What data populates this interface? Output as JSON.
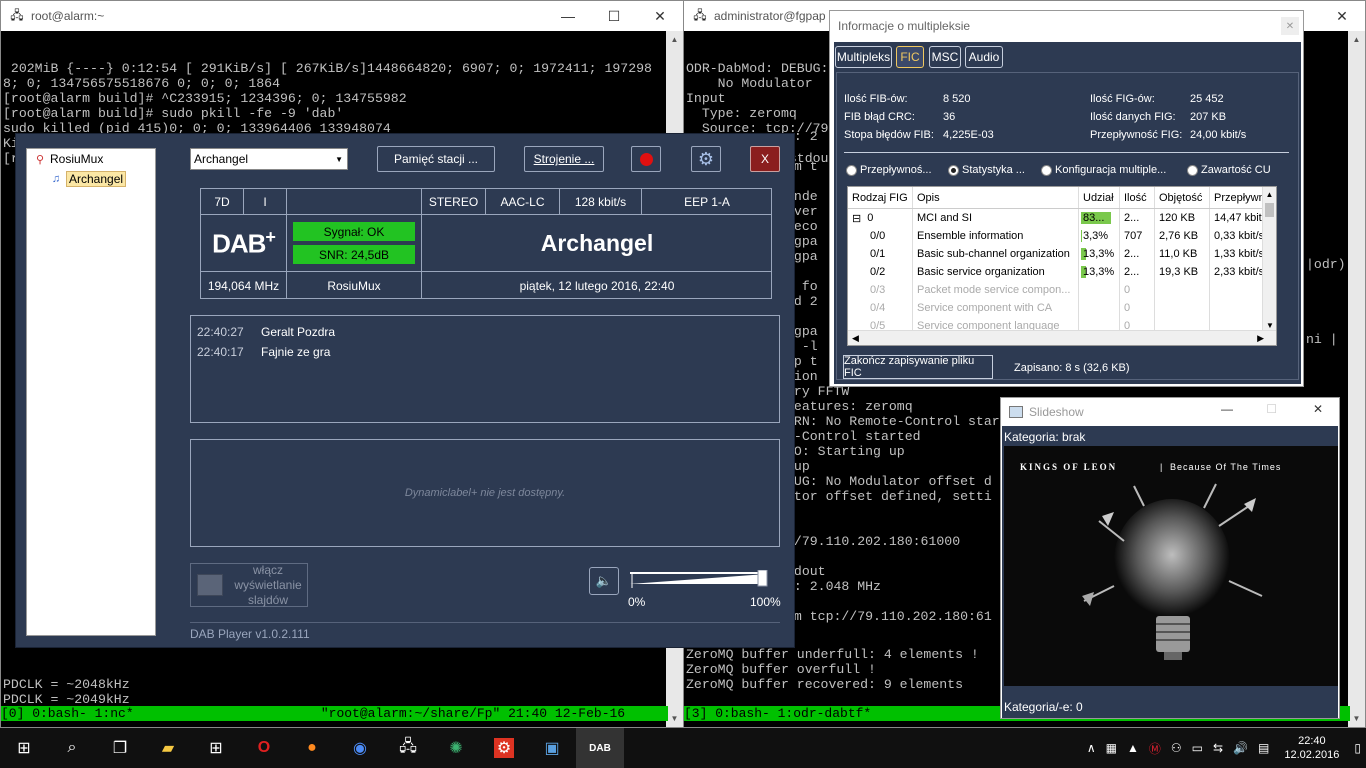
{
  "term_left": {
    "title": "root@alarm:~",
    "lines": [
      " 202MiB {----} 0:12:54 [ 291KiB/s] [ 267KiB/s]1448664820; 6907; 0; 1972411; 197298",
      "8; 0; 134756575518676 0; 0; 0; 1864",
      "[root@alarm build]# ^C233915; 1234396; 0; 134755982",
      "[root@alarm build]# sudo pkill -fe -9 'dab'",
      "sudo killed (pid 415)0; 0; 0; 133964406 133948074",
      "Killed8415; 7195; 0; 0; 0; 0; 133964060; 133964406",
      "[root@alarm build]# nc 172.20.2.23 12345 | pv -B2M -Ithera | ./dab_iS"
    ],
    "tail_lines": [
      "PDCLK = ~2048kHz",
      "PDCLK = ~2049kHz",
      "PDCLK = ~2048kHz"
    ],
    "status": "[0] 0:bash- 1:nc*                        \"root@alarm:~/share/Fp\" 21:40 12-Feb-16"
  },
  "term_right": {
    "title": "administrator@fgpap",
    "lines": [
      "ODR-DabMod: DEBUG:",
      "    No Modulator",
      "Input",
      "  Type: zeromq",
      "  Source: tcp://79",
      "Output",
      "  Name: /dev/stdout"
    ],
    "mid_lines": [
      "e: 2",
      "",
      "om t",
      "",
      "unde",
      "over",
      "reco",
      "fgpa",
      "fgpa",
      "",
      "d fo",
      "id 2",
      "",
      "fgpa",
      "c -l",
      "up t",
      "sion",
      "ary FFTW",
      "features: zeromq",
      "ARN: No Remote-Control star",
      "e-Control started",
      "FO: Starting up",
      " up",
      "BUG: No Modulator offset d",
      "ator offset defined, setti",
      "",
      "",
      "//79.110.202.180:61000",
      "",
      "tdout",
      "e: 2.048 MHz",
      "",
      "om tcp://79.110.202.180:61"
    ],
    "tail_lines": [
      "ZeroMQ buffer underfull: 4 elements !",
      "ZeroMQ buffer overfull !",
      "ZeroMQ buffer recovered: 9 elements"
    ],
    "status": "[3] 0:bash- 1:odr-dabtf*",
    "right_snips": [
      "|odr)",
      "ni |"
    ]
  },
  "dab": {
    "tree_root": "RosiuMux",
    "tree_child": "Archangel",
    "station_combo": "Archangel",
    "btn_memory": "Pamięć stacji ...",
    "btn_tuning": "Strojenie ...",
    "close": "X",
    "grid": {
      "channel": "7D",
      "i": "I",
      "stereo": "STEREO",
      "codec": "AAC-LC",
      "bitrate": "128 kbit/s",
      "eep": "EEP 1-A",
      "signal": "Sygnał: OK",
      "snr": "SNR: 24,5dB",
      "station_name": "Archangel",
      "freq": "194,064 MHz",
      "mux": "RosiuMux",
      "datetime": "piątek, 12 lutego 2016, 22:40"
    },
    "messages": [
      {
        "time": "22:40:27",
        "text": "Geralt Pozdra"
      },
      {
        "time": "22:40:17",
        "text": "Fajnie ze gra"
      }
    ],
    "dl_plus": "Dynamiclabel+ nie jest dostępny.",
    "slides_btn": [
      "włącz",
      "wyświetlanie",
      "slajdów"
    ],
    "vol_min": "0%",
    "vol_max": "100%",
    "volume": 1.0,
    "version": "DAB Player v1.0.2.111",
    "signal_color": "#22c322"
  },
  "mux": {
    "title": "Informacje o multipleksie",
    "tabs": [
      "Multipleks",
      "FIC",
      "MSC",
      "Audio"
    ],
    "active_tab": "FIC",
    "stats": {
      "fib_count_label": "Ilość FIB-ów:",
      "fib_count": "8 520",
      "fig_count_label": "Ilość FIG-ów:",
      "fig_count": "25 452",
      "crc_label": "FIB błąd CRC:",
      "crc": "36",
      "fig_data_label": "Ilość danych FIG:",
      "fig_data": "207 KB",
      "err_label": "Stopa błędów FIB:",
      "err": "4,225E-03",
      "thr_label": "Przepływność FIG:",
      "thr": "24,00 kbit/s"
    },
    "radios": [
      "Przepływnoś...",
      "Statystyka ...",
      "Konfiguracja multiple...",
      "Zawartość CU"
    ],
    "columns": [
      "Rodzaj FIG",
      "Opis",
      "Udział",
      "Ilość",
      "Objętość",
      "Przepływność"
    ],
    "rows": [
      {
        "type": "0",
        "desc": "MCI and SI",
        "share": "83...",
        "share_pct": 83,
        "count": "2...",
        "vol": "120 KB",
        "thr": "14,47 kbit/s",
        "dim": false,
        "group": true
      },
      {
        "type": "0/0",
        "desc": "Ensemble information",
        "share": "3,3%",
        "share_pct": 3.3,
        "count": "707",
        "vol": "2,76 KB",
        "thr": "0,33 kbit/s",
        "dim": false,
        "group": false
      },
      {
        "type": "0/1",
        "desc": "Basic sub-channel organization",
        "share": "13,3%",
        "share_pct": 13.3,
        "count": "2...",
        "vol": "11,0 KB",
        "thr": "1,33 kbit/s",
        "dim": false,
        "group": false
      },
      {
        "type": "0/2",
        "desc": "Basic service organization",
        "share": "13,3%",
        "share_pct": 13.3,
        "count": "2...",
        "vol": "19,3 KB",
        "thr": "2,33 kbit/s",
        "dim": false,
        "group": false
      },
      {
        "type": "0/3",
        "desc": "Packet mode service compon...",
        "share": "",
        "share_pct": 0,
        "count": "0",
        "vol": "",
        "thr": "",
        "dim": true,
        "group": false
      },
      {
        "type": "0/4",
        "desc": "Service component with CA",
        "share": "",
        "share_pct": 0,
        "count": "0",
        "vol": "",
        "thr": "",
        "dim": true,
        "group": false
      },
      {
        "type": "0/5",
        "desc": "Service component language",
        "share": "",
        "share_pct": 0,
        "count": "0",
        "vol": "",
        "thr": "",
        "dim": true,
        "group": false
      }
    ],
    "save_btn": "Zakończ zapisywanie pliku FIC",
    "saved": "Zapisano:  8 s (32,6 KB)"
  },
  "slideshow": {
    "title": "Slideshow",
    "category_top": "Kategoria: brak",
    "category_bottom": "Kategoria/-e: 0",
    "album_artist": "KINGS OF LEON",
    "album_title": "Because Of The Times"
  },
  "taskbar": {
    "time": "22:40",
    "date": "12.02.2016"
  }
}
